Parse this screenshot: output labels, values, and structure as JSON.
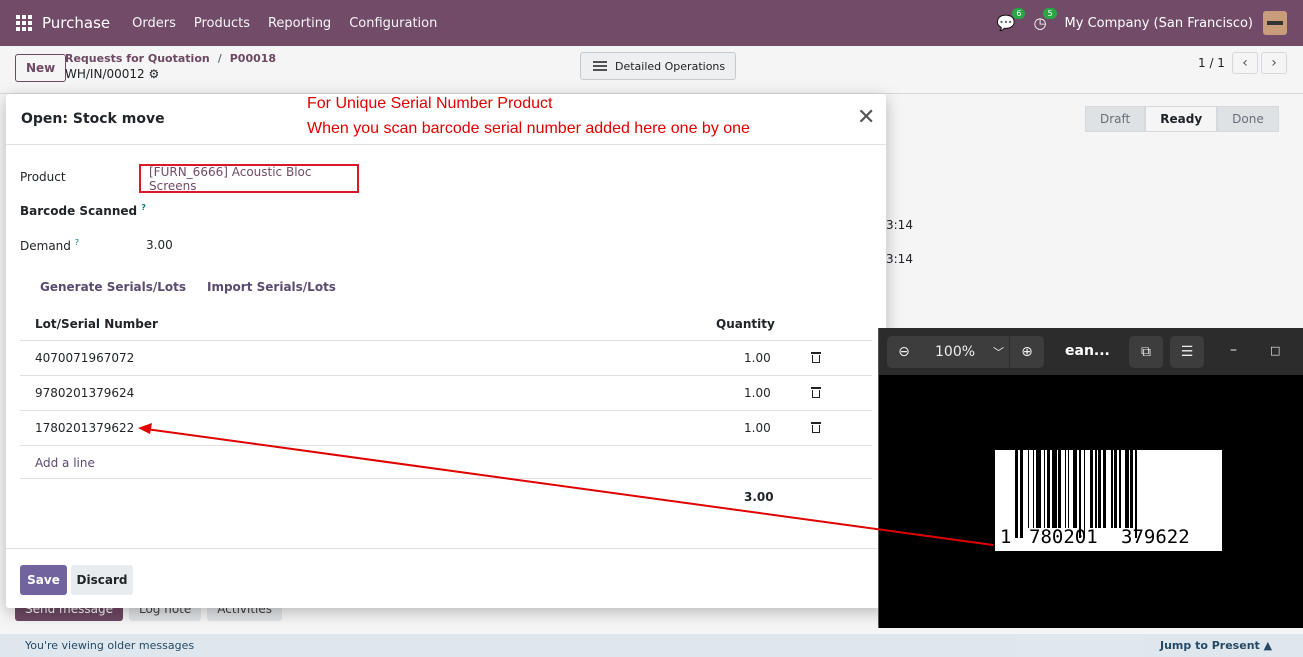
{
  "navbar": {
    "brand": "Purchase",
    "menu": [
      "Orders",
      "Products",
      "Reporting",
      "Configuration"
    ],
    "chat_badge": "6",
    "activity_badge": "5",
    "company": "My Company (San Francisco)"
  },
  "control": {
    "new_label": "New",
    "breadcrumb_root": "Requests for Quotation",
    "breadcrumb_sep": "/",
    "breadcrumb_po": "P00018",
    "record_name": "WH/IN/00012",
    "detailed_label": "Detailed Operations",
    "pager": "1 / 1"
  },
  "background": {
    "status_steps": [
      "Draft",
      "Ready",
      "Done"
    ],
    "time_1": "3:14",
    "time_2": "3:14",
    "chatter_buttons": [
      "Send message",
      "Log note",
      "Activities"
    ],
    "older_msg": "You're viewing older messages",
    "jump_present": "Jump to Present"
  },
  "annotations": {
    "line1": "For Unique Serial Number Product",
    "line2": "When you scan barcode serial number added here one by one"
  },
  "modal": {
    "title": "Open: Stock move",
    "product_label": "Product",
    "product_value": "[FURN_6666] Acoustic Bloc Screens",
    "barcode_label": "Barcode Scanned",
    "demand_label": "Demand",
    "demand_value": "3.00",
    "generate_label": "Generate Serials/Lots",
    "import_label": "Import Serials/Lots",
    "col_lot": "Lot/Serial Number",
    "col_qty": "Quantity",
    "rows": [
      {
        "lot": "4070071967072",
        "qty": "1.00"
      },
      {
        "lot": "9780201379624",
        "qty": "1.00"
      },
      {
        "lot": "1780201379622",
        "qty": "1.00"
      }
    ],
    "add_line": "Add a line",
    "total_qty": "3.00",
    "save_label": "Save",
    "discard_label": "Discard"
  },
  "viewer": {
    "zoom": "100%",
    "title": "ean...",
    "barcode_digits": [
      "1",
      "780201",
      "379622"
    ]
  },
  "colors": {
    "navbar": "#714b67",
    "annotation": "#e00000",
    "save_button": "#71639e"
  }
}
